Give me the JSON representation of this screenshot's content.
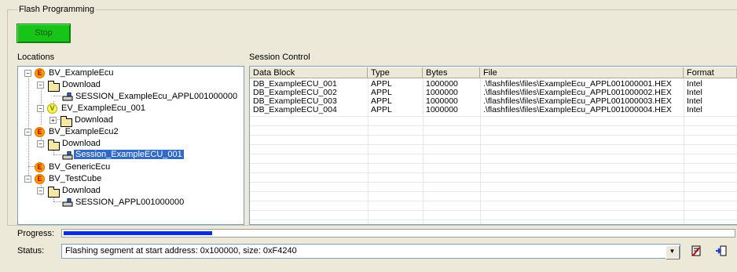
{
  "window": {
    "group_title": "Flash Programming",
    "stop_button": "Stop",
    "locations_label": "Locations",
    "session_label": "Session Control",
    "progress_label": "Progress:",
    "status_label": "Status:",
    "status_value": "Flashing segment at start address: 0x100000, size: 0xF4240",
    "progress_fraction": 0.222
  },
  "tree": {
    "n1": "BV_ExampleEcu",
    "n2": "Download",
    "n3": "SESSION_ExampleEcu_APPL001000000",
    "n4": "EV_ExampleEcu_001",
    "n5": "Download",
    "n6": "BV_ExampleEcu2",
    "n7": "Download",
    "n8": "Session_ExampleECU_001",
    "n9": "BV_GenericEcu",
    "n10": "BV_TestCube",
    "n11": "Download",
    "n12": "SESSION_APPL001000000"
  },
  "grid": {
    "headers": [
      "Data Block",
      "Type",
      "Bytes",
      "File",
      "Format"
    ],
    "rows": [
      [
        "DB_ExampleECU_001",
        "APPL",
        "1000000",
        ".\\flashfiles\\files\\ExampleEcu_APPL001000001.HEX",
        "Intel"
      ],
      [
        "DB_ExampleECU_002",
        "APPL",
        "1000000",
        ".\\flashfiles\\files\\ExampleEcu_APPL001000002.HEX",
        "Intel"
      ],
      [
        "DB_ExampleECU_003",
        "APPL",
        "1000000",
        ".\\flashfiles\\files\\ExampleEcu_APPL001000003.HEX",
        "Intel"
      ],
      [
        "DB_ExampleECU_004",
        "APPL",
        "1000000",
        ".\\flashfiles\\files\\ExampleEcu_APPL001000004.HEX",
        "Intel"
      ]
    ]
  },
  "icons": {
    "ecu_badge": "E",
    "variant_badge": "V",
    "expand": "−",
    "collapse": "+"
  }
}
